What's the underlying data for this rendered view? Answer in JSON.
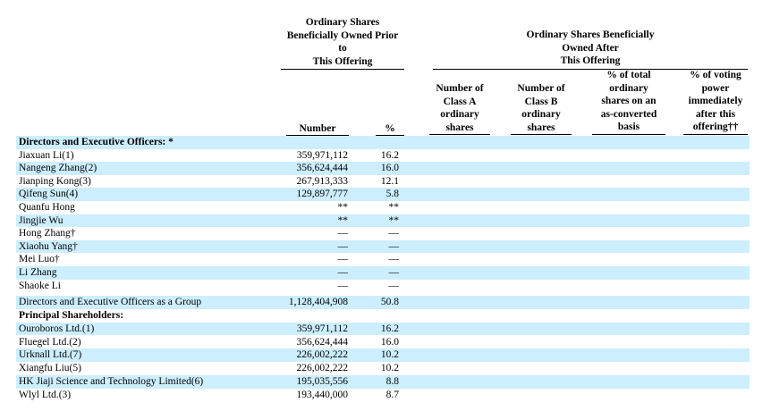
{
  "header": {
    "prior_group": [
      "Ordinary Shares",
      "Beneficially Owned Prior",
      "to",
      "This Offering"
    ],
    "after_group": [
      "Ordinary Shares Beneficially",
      "Owned After",
      "This Offering"
    ],
    "col_number": "Number",
    "col_pct": "%",
    "col_class_a": [
      "Number of",
      "Class A",
      "ordinary",
      "shares"
    ],
    "col_class_b": [
      "Number of",
      "Class B",
      "ordinary",
      "shares"
    ],
    "col_pct_total": [
      "% of total",
      "ordinary",
      "shares on an",
      "as-converted",
      "basis"
    ],
    "col_pct_voting": [
      "% of voting",
      "power",
      "immediately",
      "after this",
      "offering††"
    ]
  },
  "rows": [
    {
      "label": "Directors and Executive Officers: *",
      "bold": true,
      "number": "",
      "pct": ""
    },
    {
      "label": "Jiaxuan Li(1)",
      "bold": false,
      "number": "359,971,112",
      "pct": "16.2"
    },
    {
      "label": "Nangeng Zhang(2)",
      "bold": false,
      "number": "356,624,444",
      "pct": "16.0"
    },
    {
      "label": "Jianping Kong(3)",
      "bold": false,
      "number": "267,913,333",
      "pct": "12.1"
    },
    {
      "label": "Qifeng Sun(4)",
      "bold": false,
      "number": "129,897,777",
      "pct": "5.8"
    },
    {
      "label": "Quanfu Hong",
      "bold": false,
      "number": "**",
      "pct": "**"
    },
    {
      "label": "Jingjie Wu",
      "bold": false,
      "number": "**",
      "pct": "**"
    },
    {
      "label": "Hong Zhang†",
      "bold": false,
      "number": "—",
      "pct": "—"
    },
    {
      "label": "Xiaohu Yang†",
      "bold": false,
      "number": "—",
      "pct": "—"
    },
    {
      "label": "Mei Luo†",
      "bold": false,
      "number": "—",
      "pct": "—"
    },
    {
      "label": "Li Zhang",
      "bold": false,
      "number": "—",
      "pct": "—"
    },
    {
      "label": "Shaoke Li",
      "bold": false,
      "number": "—",
      "pct": "—"
    },
    {
      "label": "Directors and Executive Officers as a Group",
      "bold": false,
      "number": "1,128,404,908",
      "pct": "50.8"
    },
    {
      "label": "Principal Shareholders:",
      "bold": true,
      "number": "",
      "pct": ""
    },
    {
      "label": "Ouroboros Ltd.(1)",
      "bold": false,
      "number": "359,971,112",
      "pct": "16.2"
    },
    {
      "label": "Fluegel Ltd.(2)",
      "bold": false,
      "number": "356,624,444",
      "pct": "16.0"
    },
    {
      "label": "Urknall Ltd.(7)",
      "bold": false,
      "number": "226,002,222",
      "pct": "10.2"
    },
    {
      "label": "Xiangfu Liu(5)",
      "bold": false,
      "number": "226,002,222",
      "pct": "10.2"
    },
    {
      "label": "HK Jiaji Science and Technology Limited(6)",
      "bold": false,
      "number": "195,035,556",
      "pct": "8.8"
    },
    {
      "label": "Wlyl Ltd.(3)",
      "bold": false,
      "number": "193,440,000",
      "pct": "8.7"
    }
  ]
}
